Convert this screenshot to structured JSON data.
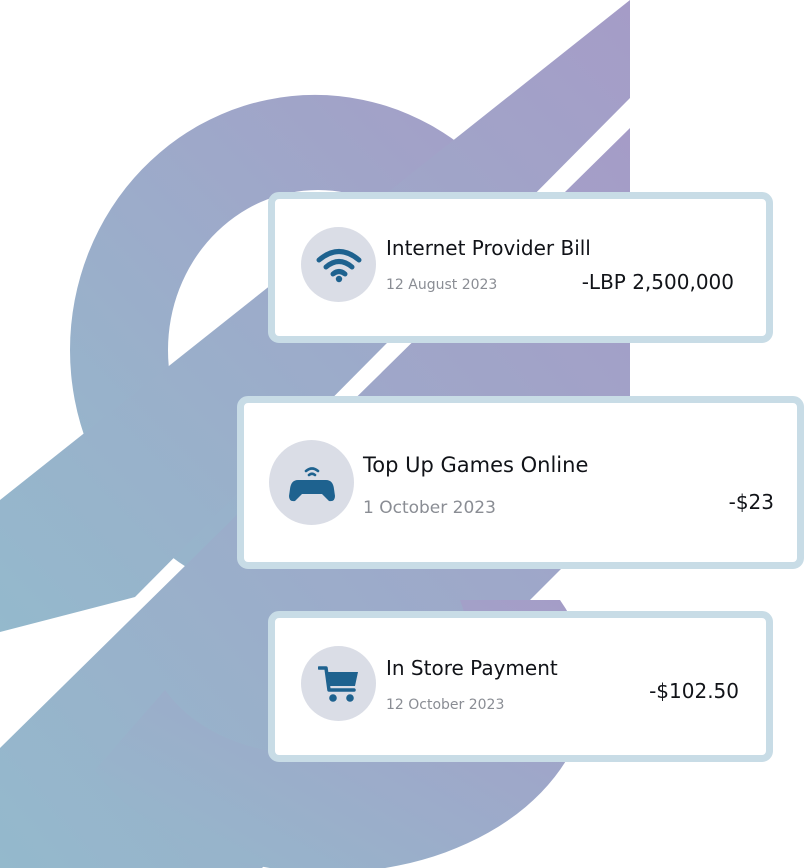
{
  "colors": {
    "accent": "#1e628f",
    "card_border": "#c8dce6",
    "icon_bg": "#dadde6",
    "text": "#111318",
    "muted": "#8a8d94",
    "art_gradient_start": "#94b9cc",
    "art_gradient_end": "#a59cc7"
  },
  "transactions": [
    {
      "title": "Internet Provider Bill",
      "date": "12 August 2023",
      "amount": "-LBP 2,500,000",
      "icon": "wifi-icon"
    },
    {
      "title": "Top Up Games Online",
      "date": "1 October 2023",
      "amount": "-$23",
      "icon": "gamepad-icon"
    },
    {
      "title": "In Store Payment",
      "date": "12 October 2023",
      "amount": "-$102.50",
      "icon": "shopping-cart-icon"
    }
  ]
}
